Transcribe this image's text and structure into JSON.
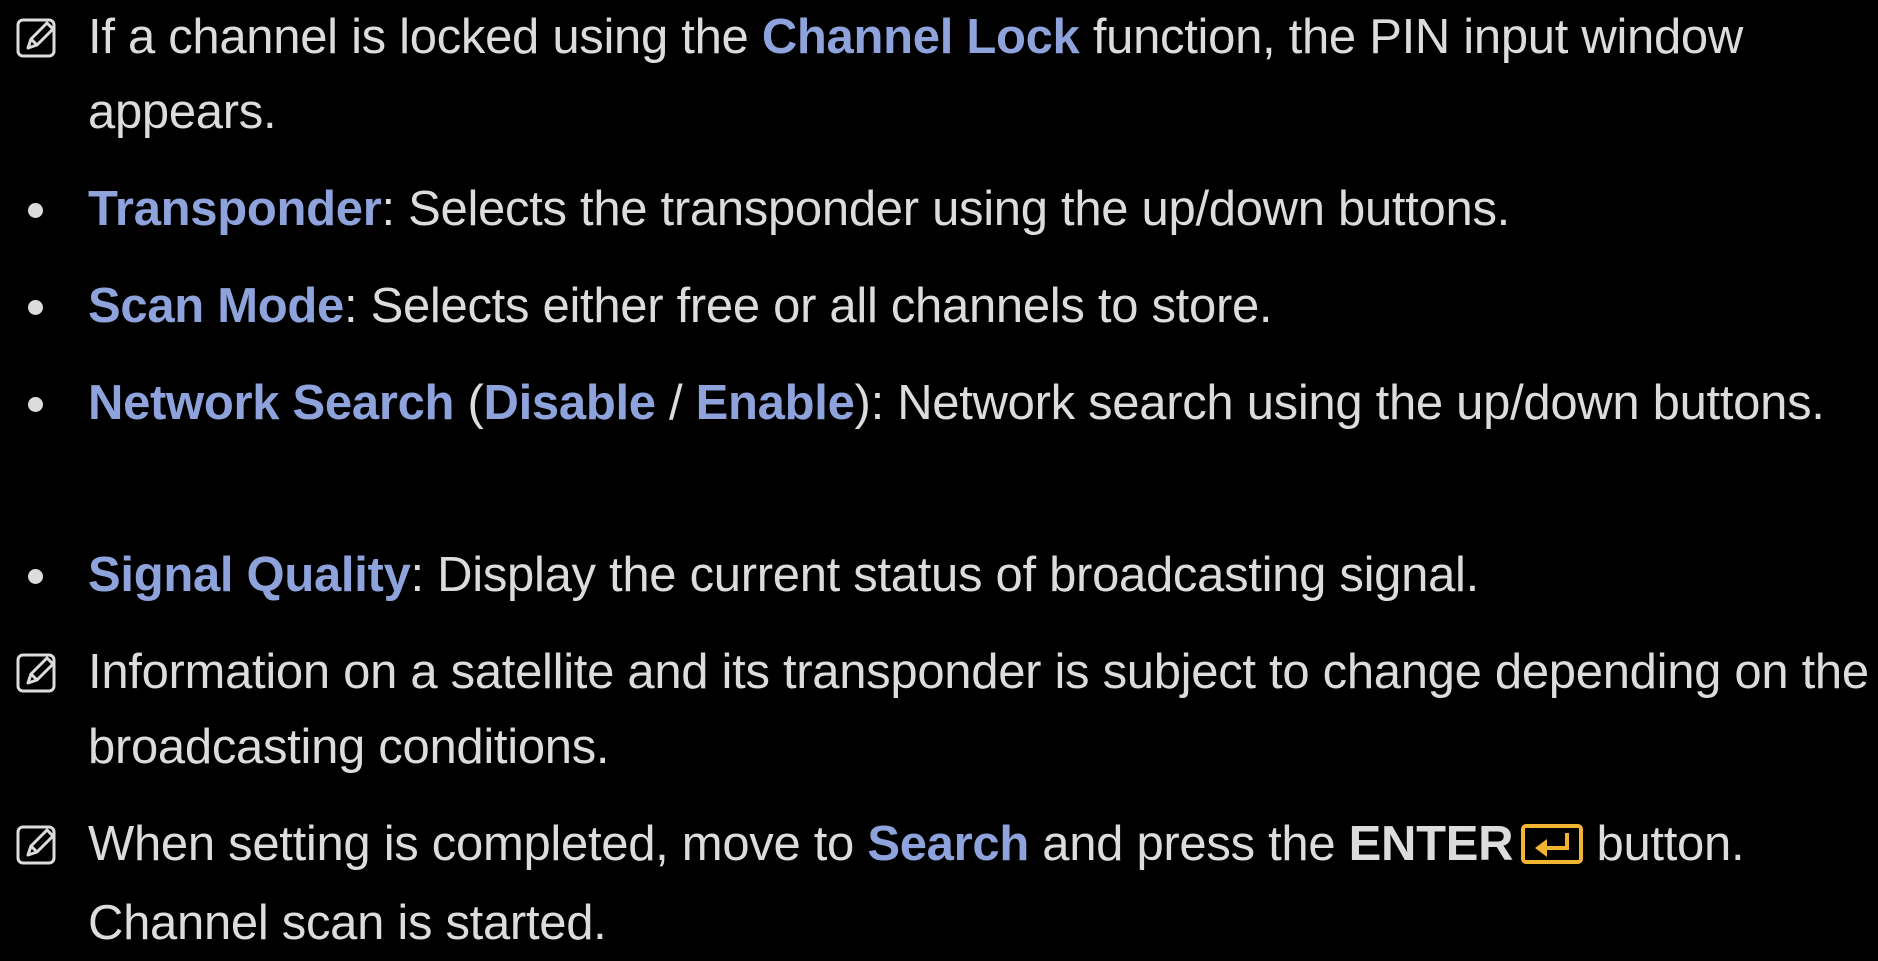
{
  "colors": {
    "background": "#000000",
    "text": "#dcdcdc",
    "highlight": "#8ea2dc",
    "enter_icon": "#f0b432"
  },
  "icons": {
    "note": "note-pencil-icon",
    "bullet": "bullet-dot",
    "enter": "enter-key-icon"
  },
  "items": [
    {
      "type": "note",
      "parts": [
        "If a channel is locked using the ",
        "Channel Lock",
        " function, the PIN input window appears."
      ]
    },
    {
      "type": "bullet",
      "parts": [
        "Transponder",
        ": Selects the transponder using the up/down buttons."
      ]
    },
    {
      "type": "bullet",
      "parts": [
        "Scan Mode",
        ": Selects either free or all channels to store."
      ]
    },
    {
      "type": "bullet",
      "parts": [
        "Network Search",
        " (",
        "Disable",
        " / ",
        "Enable",
        "): Network search using the up/down buttons."
      ]
    },
    {
      "type": "bullet",
      "parts": [
        "Signal Quality",
        ": Display the current status of broadcasting signal."
      ]
    },
    {
      "type": "note",
      "parts": [
        "Information on a satellite and its transponder is subject to change depending on the broadcasting conditions."
      ]
    },
    {
      "type": "note",
      "parts": [
        "When setting is completed, move to ",
        "Search",
        " and press the ",
        "ENTER",
        " button. Channel scan is started."
      ]
    }
  ]
}
